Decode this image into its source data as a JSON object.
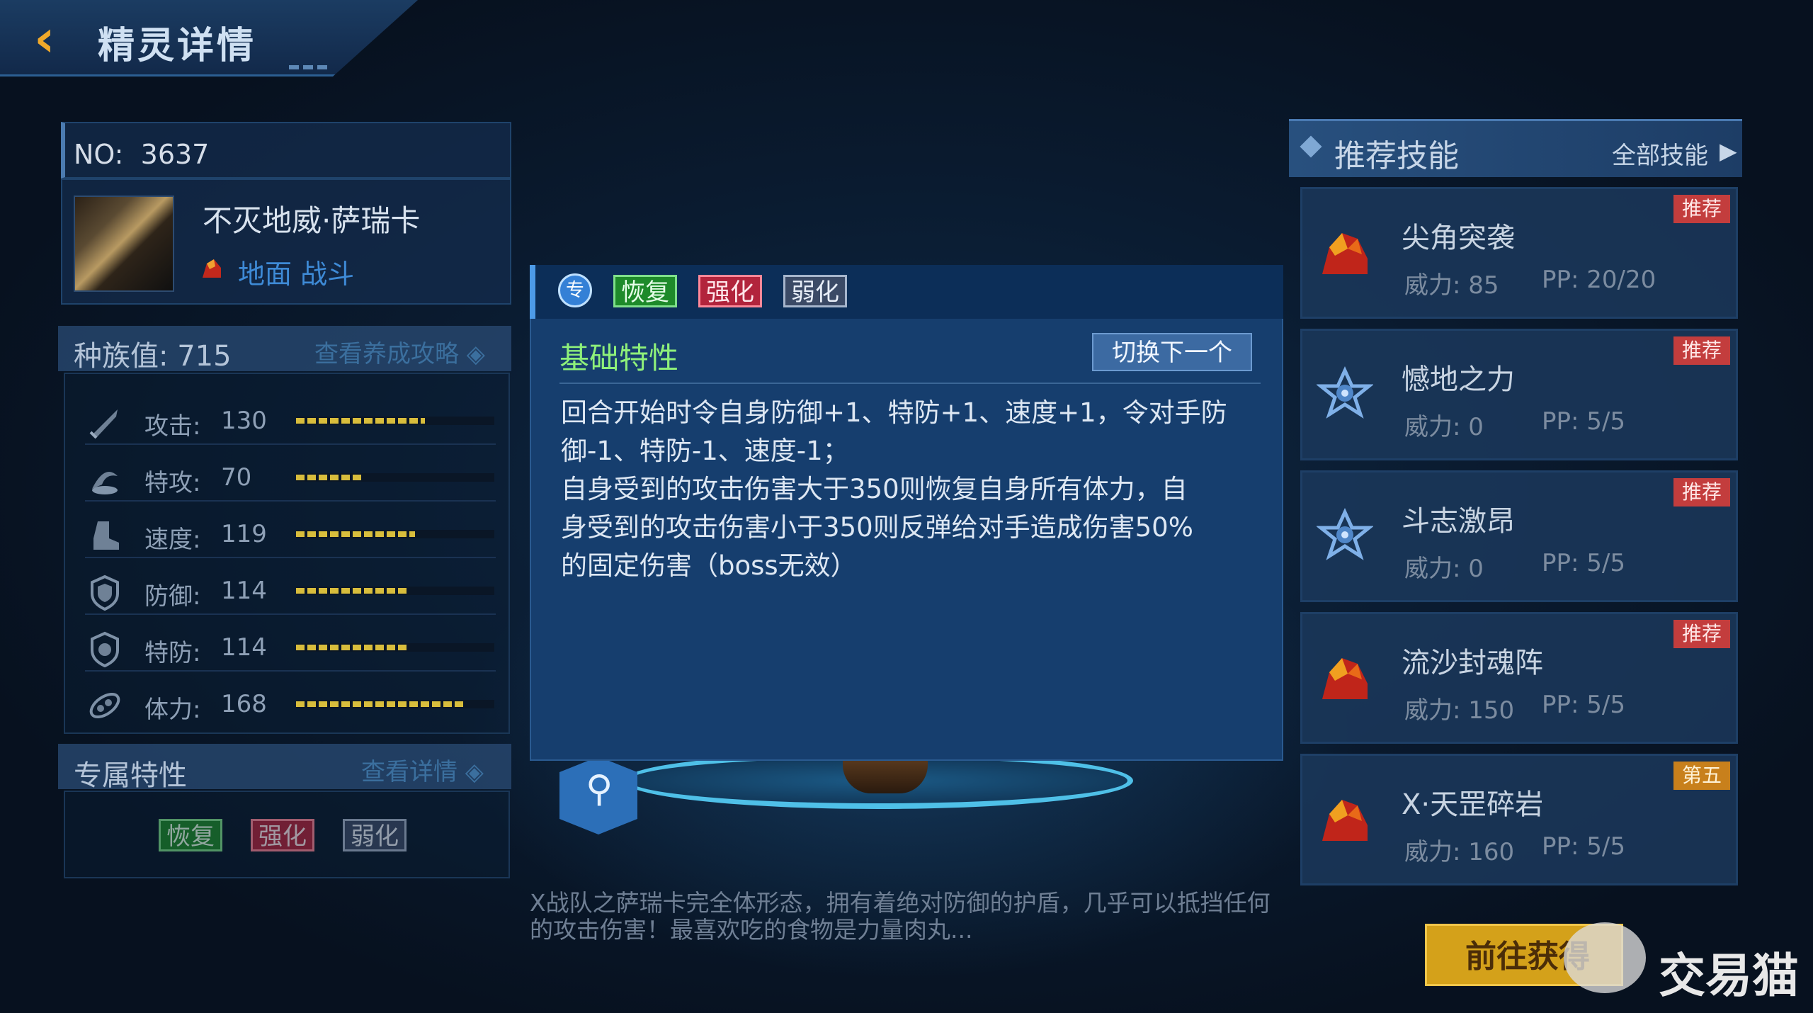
{
  "header": {
    "title": "精灵详情",
    "back_icon": "chevron-left-icon"
  },
  "pet": {
    "no_label": "NO:",
    "no_value": "3637",
    "name": "不灭地威·萨瑞卡",
    "type_text": "地面 战斗"
  },
  "race": {
    "label": "种族值:",
    "value": "715",
    "link": "查看养成攻略"
  },
  "stats": [
    {
      "icon": "sword-icon",
      "label": "攻击:",
      "value": "130",
      "fill": 0.65
    },
    {
      "icon": "special-attack-icon",
      "label": "特攻:",
      "value": "70",
      "fill": 0.33
    },
    {
      "icon": "boot-icon",
      "label": "速度:",
      "value": "119",
      "fill": 0.6
    },
    {
      "icon": "shield-icon",
      "label": "防御:",
      "value": "114",
      "fill": 0.56
    },
    {
      "icon": "special-defense-icon",
      "label": "特防:",
      "value": "114",
      "fill": 0.56
    },
    {
      "icon": "hp-icon",
      "label": "体力:",
      "value": "168",
      "fill": 0.85
    }
  ],
  "exclusive": {
    "label": "专属特性",
    "link": "查看详情",
    "tags": [
      "恢复",
      "强化",
      "弱化"
    ]
  },
  "popup": {
    "badge": "专",
    "tags": [
      "恢复",
      "强化",
      "弱化"
    ],
    "title": "基础特性",
    "switch_label": "切换下一个",
    "body": "回合开始时令自身防御+1、特防+1、速度+1，令对手防\n御-1、特防-1、速度-1；\n自身受到的攻击伤害大于350则恢复自身所有体力，自\n身受到的攻击伤害小于350则反弹给对手造成伤害50%\n的固定伤害（boss无效）"
  },
  "description": "X战队之萨瑞卡完全体形态，拥有着绝对防御的护盾，几乎可以抵挡任何的攻击伤害！最喜欢吃的食物是力量肉丸...",
  "recommend": {
    "title": "推荐技能",
    "all_label": "全部技能",
    "skills": [
      {
        "name": "尖角突袭",
        "power": "威力: 85",
        "pp": "PP: 20/20",
        "badge": "推荐",
        "icon": "rock-icon"
      },
      {
        "name": "憾地之力",
        "power": "威力: 0",
        "pp": "PP: 5/5",
        "badge": "推荐",
        "icon": "star-icon"
      },
      {
        "name": "斗志激昂",
        "power": "威力: 0",
        "pp": "PP: 5/5",
        "badge": "推荐",
        "icon": "star-icon"
      },
      {
        "name": "流沙封魂阵",
        "power": "威力: 150",
        "pp": "PP: 5/5",
        "badge": "推荐",
        "icon": "rock-icon"
      },
      {
        "name": "X·天罡碎岩",
        "power": "威力: 160",
        "pp": "PP: 5/5",
        "badge": "第五",
        "icon": "rock-icon"
      }
    ]
  },
  "goto_label": "前往获得",
  "watermark": "交易猫"
}
